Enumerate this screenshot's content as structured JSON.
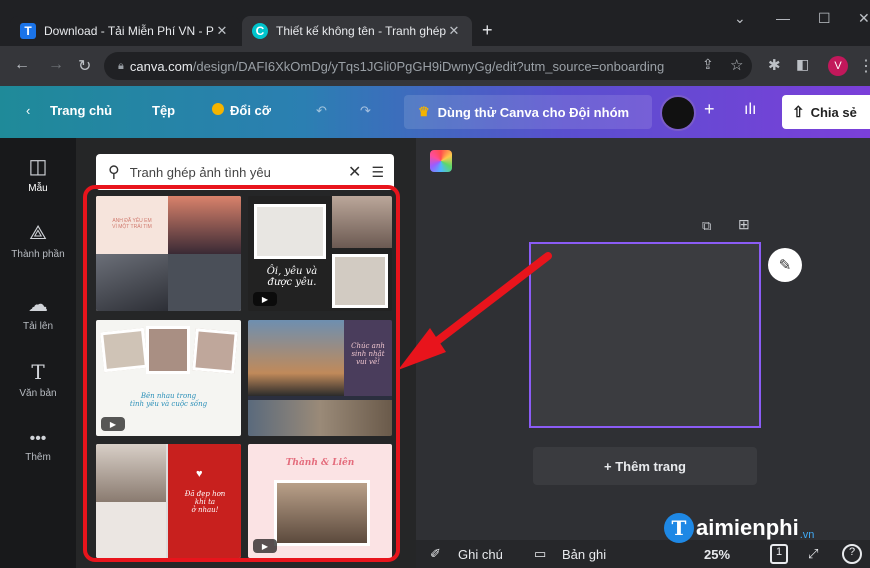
{
  "browser": {
    "tabs": [
      {
        "favicon": "T",
        "title": "Download - Tải Miễn Phí VN - Ph",
        "close": "✕"
      },
      {
        "favicon": "C",
        "title": "Thiết kế không tên - Tranh ghép",
        "close": "✕"
      }
    ],
    "new_tab": "+",
    "url_host": "canva.com",
    "url_path": "/design/DAFI6XkOmDg/yTqs1JGli0PgGH9iDwnyGg/edit?utm_source=onboarding",
    "profile_initial": "V"
  },
  "header": {
    "home": "Trang chủ",
    "file": "Tệp",
    "resize": "Đổi cỡ",
    "try_teams": "Dùng thử Canva cho Đội nhóm",
    "share": "Chia sẻ"
  },
  "rail": [
    {
      "label": "Mẫu",
      "icon": "template-icon"
    },
    {
      "label": "Thành phần",
      "icon": "elements-icon"
    },
    {
      "label": "Tải lên",
      "icon": "upload-icon"
    },
    {
      "label": "Văn bản",
      "icon": "text-icon"
    },
    {
      "label": "Thêm",
      "icon": "more-icon"
    }
  ],
  "search": {
    "value": "Tranh ghép ảnh tình yêu"
  },
  "templates": {
    "t1_text": "ANH ĐÃ YÊU EM\nVÌ MỘT TRÁI TIM",
    "t2_text": "Ôi, yêu và\nđược yêu.",
    "t3_text": "Bên nhau trong\ntình yêu và cuộc sống",
    "t4_text": "Chúc anh\nsinh nhật\nvui vẻ!",
    "t5_text": "Đã đẹp hơn\nkhi ta\nở nhau!",
    "t6_text": "Thành & Liên"
  },
  "workspace": {
    "add_page": "+ Thêm trang",
    "notes": "Ghi chú",
    "record": "Bản ghi",
    "zoom": "25%",
    "page_count": "1"
  },
  "watermark": "aimienphi",
  "watermark_sub": ".vn",
  "colors": {
    "accent_purple": "#8b5cf6",
    "annotation_red": "#e8141c"
  }
}
